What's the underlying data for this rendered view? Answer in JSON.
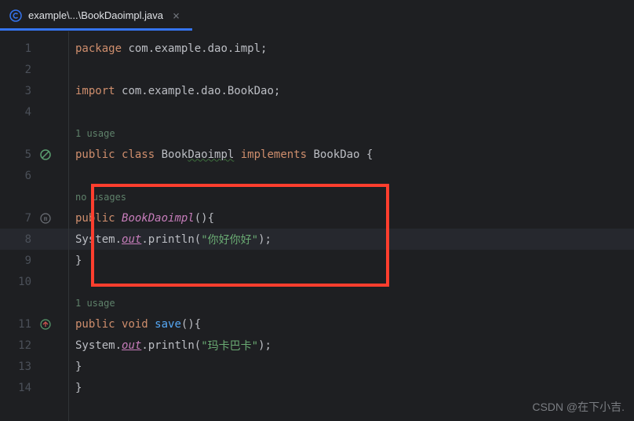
{
  "tab": {
    "label": "example\\...\\BookDaoimpl.java",
    "close": "×"
  },
  "code": {
    "line1": {
      "kw1": "package ",
      "pkg": "com.example.dao.impl",
      "semi": ";"
    },
    "line3": {
      "kw1": "import ",
      "pkg": "com.example.dao.BookDao",
      "semi": ";"
    },
    "usage1": "1 usage",
    "line5": {
      "kw1": "public ",
      "kw2": "class ",
      "cls": "Book",
      "cls2": "Daoimpl",
      "kw3": " implements ",
      "iface": "BookDao ",
      "brace": "{"
    },
    "nousages": "no usages",
    "line7": {
      "kw1": "public ",
      "ctor": "BookDaoimpl",
      "paren": "(){"
    },
    "line8": {
      "sys": "System.",
      "out": "out",
      "dot": ".",
      "method": "println",
      "open": "(",
      "str": "\"你好你好\"",
      "close": ");"
    },
    "line9": {
      "brace": "}"
    },
    "usage2": "1 usage",
    "line11": {
      "kw1": "public ",
      "kw2": "void ",
      "method": "save",
      "paren": "(){"
    },
    "line12": {
      "sys": "System.",
      "out": "out",
      "dot": ".",
      "method": "println",
      "open": "(",
      "str": "\"玛卡巴卡\"",
      "close": ");"
    },
    "line13": {
      "brace": "}"
    },
    "line14": {
      "brace": "}"
    }
  },
  "gutter": {
    "l1": "1",
    "l2": "2",
    "l3": "3",
    "l4": "4",
    "l5": "5",
    "l6": "6",
    "l7": "7",
    "l8": "8",
    "l9": "9",
    "l10": "10",
    "l11": "11",
    "l12": "12",
    "l13": "13",
    "l14": "14"
  },
  "watermark": "CSDN @在下小吉."
}
